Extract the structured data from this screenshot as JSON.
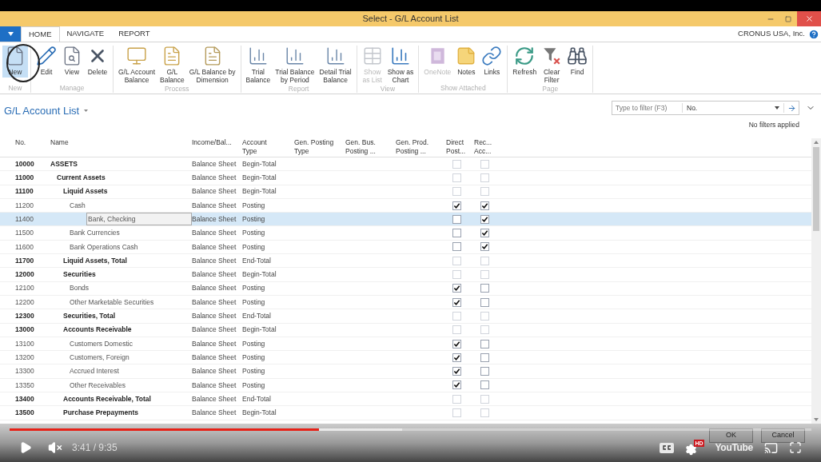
{
  "window": {
    "title": "Select - G/L Account List"
  },
  "menu_tabs": [
    {
      "label": "HOME",
      "selected": true
    },
    {
      "label": "NAVIGATE",
      "selected": false
    },
    {
      "label": "REPORT",
      "selected": false
    }
  ],
  "company": "CRONUS USA, Inc.",
  "ribbon": [
    {
      "label": "New",
      "actions": [
        {
          "label": "New",
          "disabled": false,
          "highlighted": true
        }
      ]
    },
    {
      "label": "Manage",
      "actions": [
        {
          "label": "Edit",
          "disabled": false,
          "highlighted": false
        },
        {
          "label": "View",
          "disabled": false,
          "highlighted": false
        },
        {
          "label": "Delete",
          "disabled": false,
          "highlighted": false
        }
      ]
    },
    {
      "label": "Process",
      "actions": [
        {
          "label": "G/L Account\nBalance",
          "disabled": false,
          "highlighted": false
        },
        {
          "label": "G/L\nBalance",
          "disabled": false,
          "highlighted": false
        },
        {
          "label": "G/L Balance by\nDimension",
          "disabled": false,
          "highlighted": false
        }
      ]
    },
    {
      "label": "Report",
      "actions": [
        {
          "label": "Trial\nBalance",
          "disabled": false,
          "highlighted": false
        },
        {
          "label": "Trial Balance\nby Period",
          "disabled": false,
          "highlighted": false
        },
        {
          "label": "Detail Trial\nBalance",
          "disabled": false,
          "highlighted": false
        }
      ]
    },
    {
      "label": "View",
      "actions": [
        {
          "label": "Show\nas List",
          "disabled": true,
          "highlighted": false
        },
        {
          "label": "Show as\nChart",
          "disabled": false,
          "highlighted": false
        }
      ]
    },
    {
      "label": "Show Attached",
      "actions": [
        {
          "label": "OneNote",
          "disabled": true,
          "highlighted": false
        },
        {
          "label": "Notes",
          "disabled": false,
          "highlighted": false
        },
        {
          "label": "Links",
          "disabled": false,
          "highlighted": false
        }
      ]
    },
    {
      "label": "Page",
      "actions": [
        {
          "label": "Refresh",
          "disabled": false,
          "highlighted": false
        },
        {
          "label": "Clear\nFilter",
          "disabled": false,
          "highlighted": false
        },
        {
          "label": "Find",
          "disabled": false,
          "highlighted": false
        }
      ]
    }
  ],
  "page_title": "G/L Account List",
  "filter": {
    "placeholder": "Type to filter (F3)",
    "field": "No.",
    "status": "No filters applied"
  },
  "table": {
    "columns": [
      "No.",
      "Name",
      "Income/Bal...",
      "Account\nType",
      "Gen. Posting\nType",
      "Gen. Bus.\nPosting ...",
      "Gen. Prod.\nPosting ...",
      "Direct\nPost...",
      "Rec...\nAcc..."
    ],
    "rows": [
      {
        "no": "10000",
        "name": "ASSETS",
        "kind": "heading",
        "income_balance": "Balance Sheet",
        "account_type": "Begin-Total",
        "direct_posting": false,
        "reconciliation": false,
        "selected": false,
        "children": [
          {
            "no": "11000",
            "name": "Current Assets",
            "kind": "heading",
            "income_balance": "Balance Sheet",
            "account_type": "Begin-Total",
            "direct_posting": false,
            "reconciliation": false,
            "selected": false,
            "children": [
              {
                "no": "11100",
                "name": "Liquid Assets",
                "kind": "heading",
                "income_balance": "Balance Sheet",
                "account_type": "Begin-Total",
                "direct_posting": false,
                "reconciliation": false,
                "selected": false,
                "children": [
                  {
                    "no": "11200",
                    "name": "Cash",
                    "kind": "posting",
                    "income_balance": "Balance Sheet",
                    "account_type": "Posting",
                    "direct_posting": true,
                    "reconciliation": true,
                    "selected": false
                  },
                  {
                    "no": "11400",
                    "name": "Bank, Checking",
                    "kind": "posting",
                    "income_balance": "Balance Sheet",
                    "account_type": "Posting",
                    "direct_posting": false,
                    "reconciliation": true,
                    "selected": true
                  },
                  {
                    "no": "11500",
                    "name": "Bank Currencies",
                    "kind": "posting",
                    "income_balance": "Balance Sheet",
                    "account_type": "Posting",
                    "direct_posting": false,
                    "reconciliation": true,
                    "selected": false
                  },
                  {
                    "no": "11600",
                    "name": "Bank Operations Cash",
                    "kind": "posting",
                    "income_balance": "Balance Sheet",
                    "account_type": "Posting",
                    "direct_posting": false,
                    "reconciliation": true,
                    "selected": false
                  }
                ]
              },
              {
                "no": "11700",
                "name": "Liquid Assets, Total",
                "kind": "heading",
                "income_balance": "Balance Sheet",
                "account_type": "End-Total",
                "direct_posting": false,
                "reconciliation": false,
                "selected": false
              },
              {
                "no": "12000",
                "name": "Securities",
                "kind": "heading",
                "income_balance": "Balance Sheet",
                "account_type": "Begin-Total",
                "direct_posting": false,
                "reconciliation": false,
                "selected": false,
                "children": [
                  {
                    "no": "12100",
                    "name": "Bonds",
                    "kind": "posting",
                    "income_balance": "Balance Sheet",
                    "account_type": "Posting",
                    "direct_posting": true,
                    "reconciliation": false,
                    "selected": false
                  },
                  {
                    "no": "12200",
                    "name": "Other Marketable Securities",
                    "kind": "posting",
                    "income_balance": "Balance Sheet",
                    "account_type": "Posting",
                    "direct_posting": true,
                    "reconciliation": false,
                    "selected": false
                  }
                ]
              },
              {
                "no": "12300",
                "name": "Securities, Total",
                "kind": "heading",
                "income_balance": "Balance Sheet",
                "account_type": "End-Total",
                "direct_posting": false,
                "reconciliation": false,
                "selected": false
              },
              {
                "no": "13000",
                "name": "Accounts Receivable",
                "kind": "heading",
                "income_balance": "Balance Sheet",
                "account_type": "Begin-Total",
                "direct_posting": false,
                "reconciliation": false,
                "selected": false,
                "children": [
                  {
                    "no": "13100",
                    "name": "Customers Domestic",
                    "kind": "posting",
                    "income_balance": "Balance Sheet",
                    "account_type": "Posting",
                    "direct_posting": true,
                    "reconciliation": false,
                    "selected": false
                  },
                  {
                    "no": "13200",
                    "name": "Customers, Foreign",
                    "kind": "posting",
                    "income_balance": "Balance Sheet",
                    "account_type": "Posting",
                    "direct_posting": true,
                    "reconciliation": false,
                    "selected": false
                  },
                  {
                    "no": "13300",
                    "name": "Accrued Interest",
                    "kind": "posting",
                    "income_balance": "Balance Sheet",
                    "account_type": "Posting",
                    "direct_posting": true,
                    "reconciliation": false,
                    "selected": false
                  },
                  {
                    "no": "13350",
                    "name": "Other Receivables",
                    "kind": "posting",
                    "income_balance": "Balance Sheet",
                    "account_type": "Posting",
                    "direct_posting": true,
                    "reconciliation": false,
                    "selected": false
                  }
                ]
              },
              {
                "no": "13400",
                "name": "Accounts Receivable, Total",
                "kind": "heading",
                "income_balance": "Balance Sheet",
                "account_type": "End-Total",
                "direct_posting": false,
                "reconciliation": false,
                "selected": false
              },
              {
                "no": "13500",
                "name": "Purchase Prepayments",
                "kind": "heading",
                "income_balance": "Balance Sheet",
                "account_type": "Begin-Total",
                "direct_posting": false,
                "reconciliation": false,
                "selected": false
              }
            ]
          }
        ]
      }
    ]
  },
  "buttons": [
    "OK",
    "Cancel"
  ],
  "player": {
    "paused": true,
    "muted": true,
    "time": "3:41 / 9:35",
    "progress": {
      "level": 0.386
    },
    "quality": "HD",
    "logo": "YouTube"
  }
}
